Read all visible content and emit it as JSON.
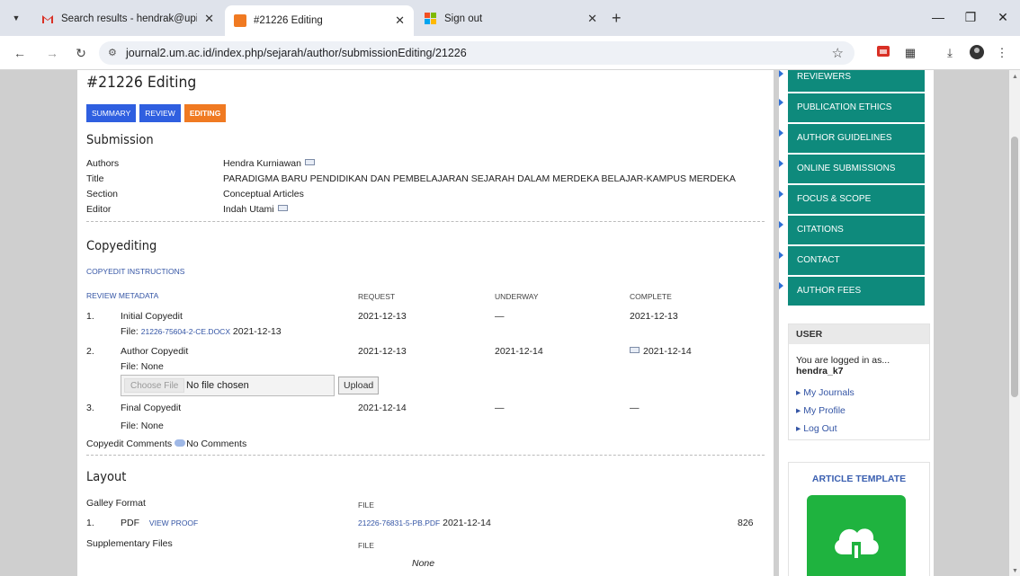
{
  "browser": {
    "tabs": [
      {
        "title": "Search results - hendrak@upi.e",
        "favicon": "gmail-icon"
      },
      {
        "title": "#21226 Editing",
        "favicon": "ojs-icon"
      },
      {
        "title": "Sign out",
        "favicon": "microsoft-icon"
      }
    ],
    "url": "journal2.um.ac.id/index.php/sejarah/author/submissionEditing/21226"
  },
  "page": {
    "title": "#21226 Editing",
    "tabs": [
      "Summary",
      "Review",
      "Editing"
    ],
    "active_tab": "Editing"
  },
  "submission": {
    "heading": "Submission",
    "authors_label": "Authors",
    "authors": "Hendra Kurniawan",
    "title_label": "Title",
    "title": "PARADIGMA BARU PENDIDIKAN DAN PEMBELAJARAN SEJARAH DALAM MERDEKA BELAJAR-KAMPUS MERDEKA",
    "section_label": "Section",
    "section": "Conceptual Articles",
    "editor_label": "Editor",
    "editor": "Indah Utami"
  },
  "copyediting": {
    "heading": "Copyediting",
    "instructions": "Copyedit Instructions",
    "review_metadata": "Review Metadata",
    "col_request": "Request",
    "col_underway": "Underway",
    "col_complete": "Complete",
    "rows": [
      {
        "num": "1.",
        "name": "Initial Copyedit",
        "request": "2021-12-13",
        "underway": "—",
        "complete": "2021-12-13"
      },
      {
        "num": "2.",
        "name": "Author Copyedit",
        "request": "2021-12-13",
        "underway": "2021-12-14",
        "complete": "2021-12-14"
      },
      {
        "num": "3.",
        "name": "Final Copyedit",
        "request": "2021-12-14",
        "underway": "—",
        "complete": "—"
      }
    ],
    "file1_label": "File:",
    "file1_name": "21226-75604-2-CE.DOCX",
    "file1_date": "2021-12-13",
    "file2": "File: None",
    "choose_file": "Choose File",
    "no_file": "No file chosen",
    "upload": "Upload",
    "file3": "File: None",
    "comments_label": "Copyedit Comments",
    "comments_value": "No Comments"
  },
  "layout": {
    "heading": "Layout",
    "galley_format": "Galley Format",
    "file_col": "File",
    "galley_num": "1.",
    "galley_type": "PDF",
    "view_proof": "View Proof",
    "galley_file": "21226-76831-5-PB.PDF",
    "galley_date": "2021-12-14",
    "galley_count": "826",
    "supp_files": "Supplementary Files",
    "supp_file_col": "File",
    "supp_none": "None"
  },
  "sidebar": {
    "nav": [
      "Reviewers",
      "Publication Ethics",
      "Author Guidelines",
      "Online Submissions",
      "Focus & Scope",
      "Citations",
      "Contact",
      "Author Fees"
    ],
    "user_heading": "User",
    "logged_in_as": "You are logged in as...",
    "username": "hendra_k7",
    "links": [
      "My Journals",
      "My Profile",
      "Log Out"
    ],
    "template_heading": "Article Template"
  },
  "colors": {
    "nav_teal": "#0e8a7c",
    "tab_blue": "#2f5fe0",
    "tab_orange": "#f07a22",
    "link": "#3455a5"
  }
}
